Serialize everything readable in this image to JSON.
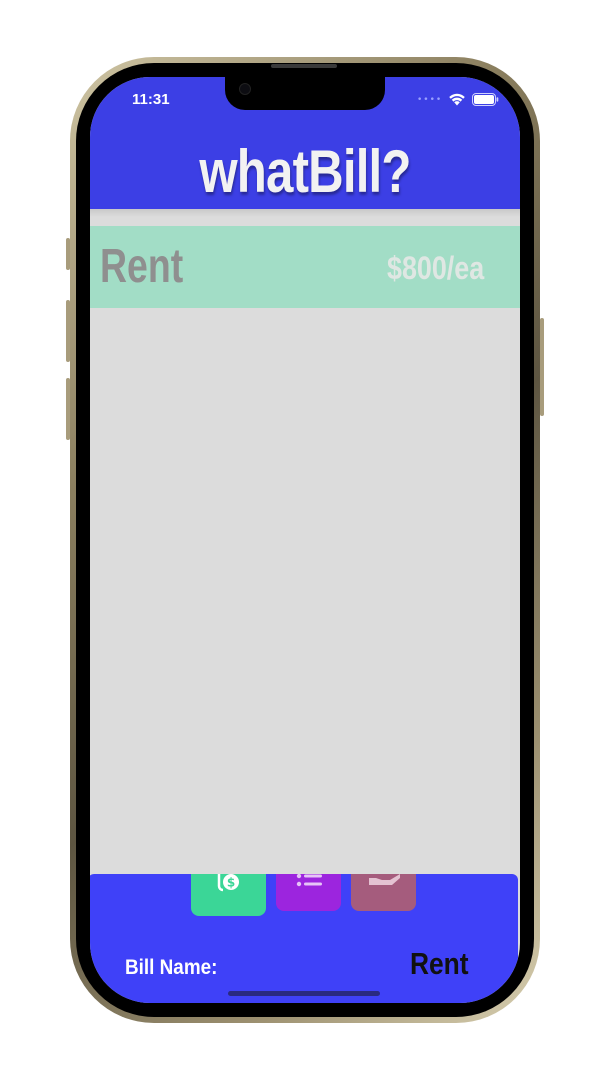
{
  "status_bar": {
    "time": "11:31"
  },
  "header": {
    "title": "whatBill?"
  },
  "bills": [
    {
      "name": "Rent",
      "amount": "$800/ea"
    }
  ],
  "bottom_panel": {
    "tabs": [
      {
        "icon": "money-icon",
        "color": "#3bd697"
      },
      {
        "icon": "list-icon",
        "color": "#9c25de"
      },
      {
        "icon": "hand-pay-icon",
        "color": "#a55c7d"
      }
    ],
    "field_label": "Bill Name:",
    "field_value": "Rent"
  },
  "colors": {
    "header": "#3c3fe5",
    "row": "#a2ddc6",
    "panel": "#3f41f8"
  }
}
